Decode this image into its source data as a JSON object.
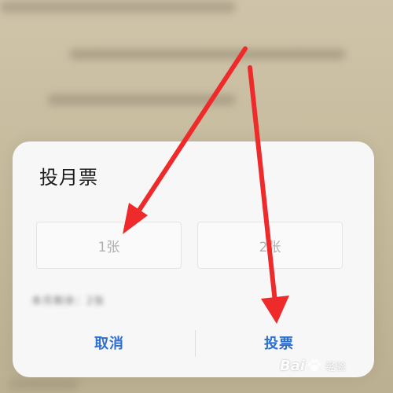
{
  "dialog": {
    "title": "投月票",
    "options": [
      {
        "label": "1张"
      },
      {
        "label": "2张"
      }
    ],
    "remaining_text": "本月剩余：2张",
    "cancel_label": "取消",
    "vote_label": "投票"
  },
  "watermark": {
    "text_left": "Bai",
    "text_right": "经验"
  },
  "colors": {
    "accent": "#2a6fd1",
    "annotation_arrow": "#ee2a2a"
  }
}
